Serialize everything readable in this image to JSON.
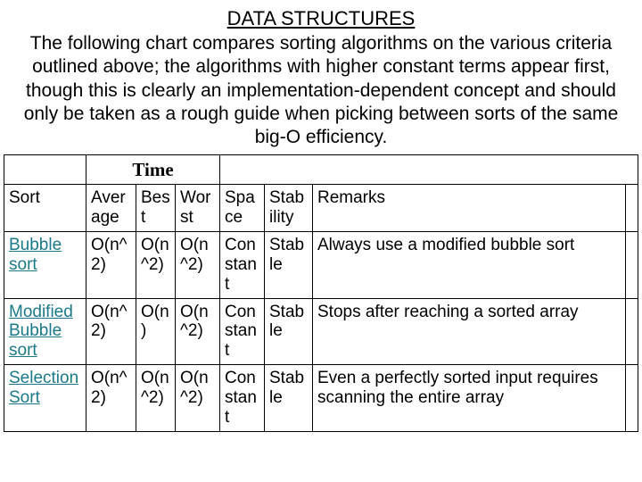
{
  "title": "DATA STRUCTURES",
  "intro": "The following chart compares sorting algorithms on the various criteria outlined above; the algorithms with higher constant terms appear first, though this is clearly an implementation-dependent concept and should only be taken as a rough guide when picking between sorts of the same big-O efficiency.",
  "header": {
    "time_group": "Time",
    "sort": "Sort",
    "average": "Average",
    "best": "Best",
    "worst": "Worst",
    "space": "Space",
    "stability": "Stability",
    "remarks": "Remarks"
  },
  "rows": [
    {
      "name": "Bubble sort",
      "average": "O(n^2)",
      "best": "O(n^2)",
      "worst": "O(n^2)",
      "space": "Constant",
      "stability": "Stable",
      "remarks": "Always use a modified bubble sort"
    },
    {
      "name": "Modified Bubble sort",
      "average": "O(n^2)",
      "best": "O(n)",
      "worst": "O(n^2)",
      "space": "Constant",
      "stability": "Stable",
      "remarks": "Stops after reaching a sorted array"
    },
    {
      "name": "Selection Sort",
      "average": "O(n^2)",
      "best": "O(n^2)",
      "worst": "O(n^2)",
      "space": "Constant",
      "stability": "Stable",
      "remarks": "Even a perfectly sorted input requires scanning the entire array"
    }
  ],
  "chart_data": {
    "type": "table",
    "title": "Sorting algorithm comparison",
    "columns": [
      "Sort",
      "Average",
      "Best",
      "Worst",
      "Space",
      "Stability",
      "Remarks"
    ],
    "rows": [
      [
        "Bubble sort",
        "O(n^2)",
        "O(n^2)",
        "O(n^2)",
        "Constant",
        "Stable",
        "Always use a modified bubble sort"
      ],
      [
        "Modified Bubble sort",
        "O(n^2)",
        "O(n)",
        "O(n^2)",
        "Constant",
        "Stable",
        "Stops after reaching a sorted array"
      ],
      [
        "Selection Sort",
        "O(n^2)",
        "O(n^2)",
        "O(n^2)",
        "Constant",
        "Stable",
        "Even a perfectly sorted input requires scanning the entire array"
      ]
    ]
  }
}
